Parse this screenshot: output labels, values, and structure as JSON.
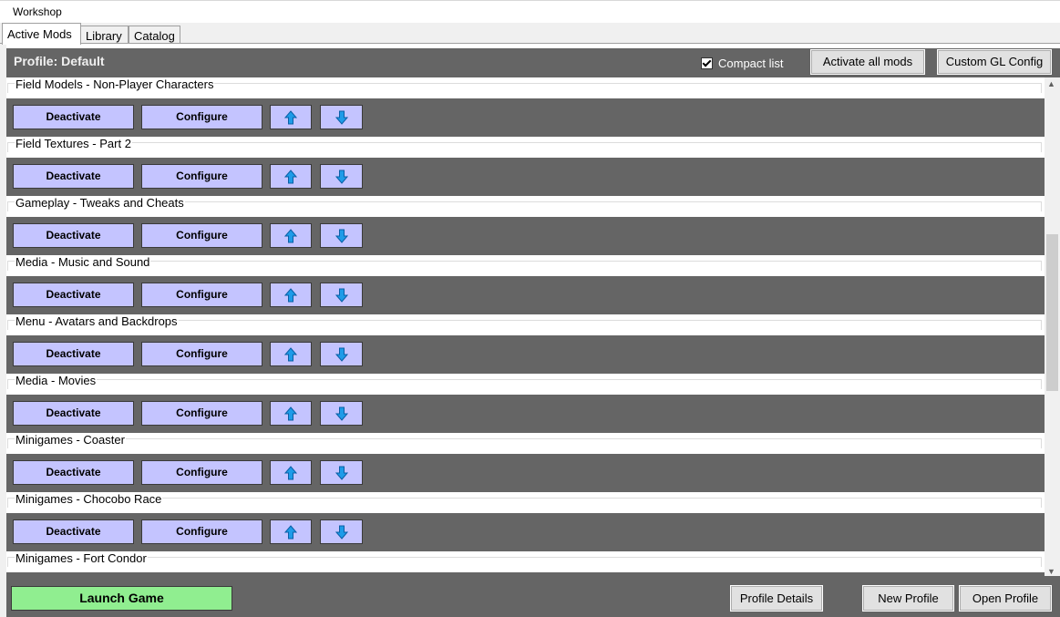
{
  "window": {
    "title": "Workshop"
  },
  "tabs": [
    {
      "label": "Active Mods",
      "active": true
    },
    {
      "label": "Library",
      "active": false
    },
    {
      "label": "Catalog",
      "active": false
    }
  ],
  "profile": {
    "label": "Profile: Default",
    "compact_list_label": "Compact list",
    "compact_list_checked": true,
    "activate_all_label": "Activate all mods",
    "custom_gl_label": "Custom GL Config"
  },
  "mod_buttons": {
    "deactivate": "Deactivate",
    "configure": "Configure",
    "up_icon": "arrow-up-icon",
    "down_icon": "arrow-down-icon"
  },
  "mods": [
    {
      "name": "Field Models - Non-Player Characters"
    },
    {
      "name": "Field Textures - Part 2"
    },
    {
      "name": "Gameplay - Tweaks and Cheats"
    },
    {
      "name": "Media - Music and Sound"
    },
    {
      "name": "Menu - Avatars and Backdrops"
    },
    {
      "name": "Media - Movies"
    },
    {
      "name": "Minigames - Coaster"
    },
    {
      "name": "Minigames - Chocobo Race"
    },
    {
      "name": "Minigames - Fort Condor"
    }
  ],
  "footer": {
    "launch_label": "Launch Game",
    "profile_details_label": "Profile Details",
    "new_profile_label": "New Profile",
    "open_profile_label": "Open Profile"
  },
  "colors": {
    "bar_bg": "#656565",
    "mod_button_bg": "#c4c4ff",
    "launch_bg": "#90ee90",
    "arrow_blue": "#1e9be8"
  }
}
